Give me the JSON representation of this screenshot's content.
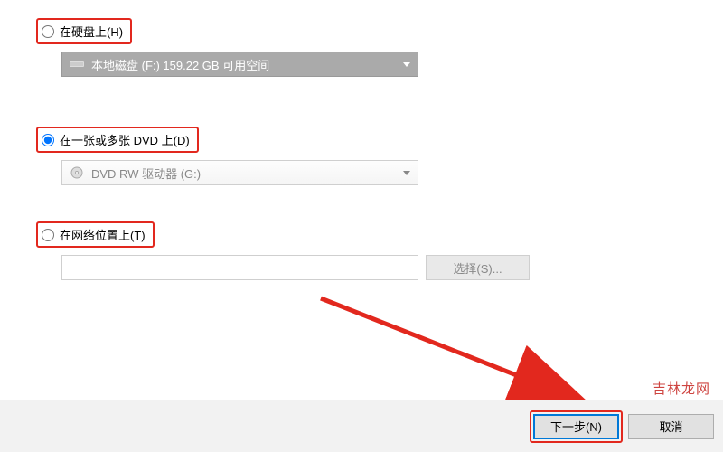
{
  "options": {
    "hdd": {
      "label": "在硬盘上(H)",
      "dropdown_text": "本地磁盘 (F:)  159.22 GB 可用空间",
      "selected": false
    },
    "dvd": {
      "label": "在一张或多张 DVD 上(D)",
      "dropdown_text": "DVD RW 驱动器 (G:)",
      "selected": true
    },
    "network": {
      "label": "在网络位置上(T)",
      "input_value": "",
      "browse_label": "选择(S)...",
      "selected": false
    }
  },
  "footer": {
    "next_label": "下一步(N)",
    "cancel_label": "取消"
  },
  "watermark": "吉林龙网"
}
